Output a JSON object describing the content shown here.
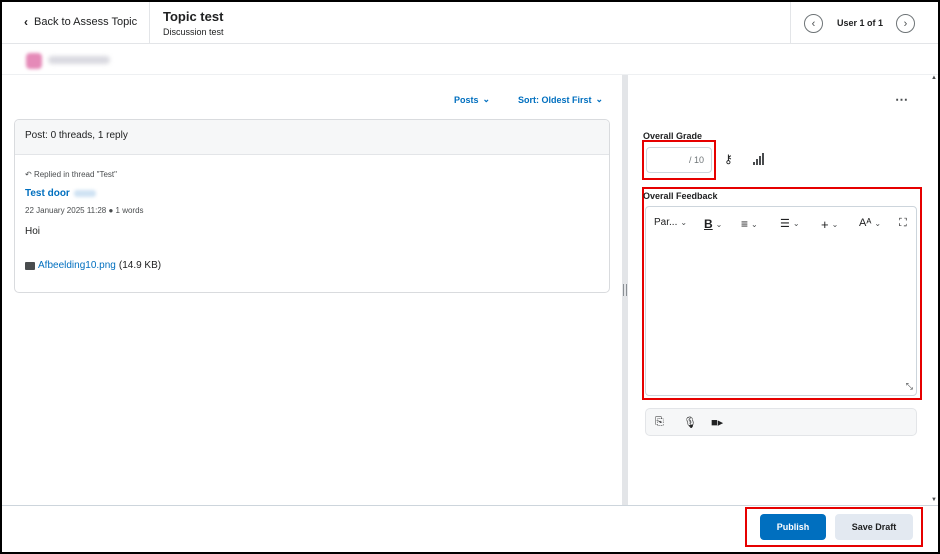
{
  "header": {
    "back_label": "Back to Assess Topic",
    "title": "Topic test",
    "subtitle": "Discussion test",
    "user_count": "User 1 of 1"
  },
  "toolbar": {
    "posts_label": "Posts",
    "sort_label": "Sort: Oldest First"
  },
  "posts": {
    "summary": "Post: 0 threads, 1 reply",
    "items": [
      {
        "replied_in": "Replied in thread \"Test\"",
        "title": "Test door",
        "meta": "22 January 2025 11:28 ● 1 words",
        "body": "Hoi",
        "attachment_name": "Afbeelding10.png",
        "attachment_size": "(14.9 KB)"
      }
    ]
  },
  "grading": {
    "grade_label": "Overall Grade",
    "grade_value": "",
    "grade_out_of": "/ 10",
    "feedback_label": "Overall Feedback",
    "editor_tools": {
      "paragraph": "Par...",
      "bold": "B",
      "align": "≡",
      "list": "☰",
      "insert": "+",
      "format": "Aᴬ"
    }
  },
  "footer": {
    "publish_label": "Publish",
    "save_draft_label": "Save Draft"
  },
  "icons": {
    "back": "chevron-left-icon",
    "prev": "chevron-left-circle-icon",
    "next": "chevron-right-circle-icon",
    "more": "more-options-icon",
    "key": "key-icon",
    "stats": "bar-chart-icon",
    "attach": "paperclip-icon",
    "record_audio": "microphone-icon",
    "record_video": "video-camera-icon",
    "fullscreen": "fullscreen-icon",
    "image": "image-icon",
    "reply": "reply-icon"
  },
  "colors": {
    "accent": "#006fbf",
    "highlight_box": "#e60000"
  }
}
